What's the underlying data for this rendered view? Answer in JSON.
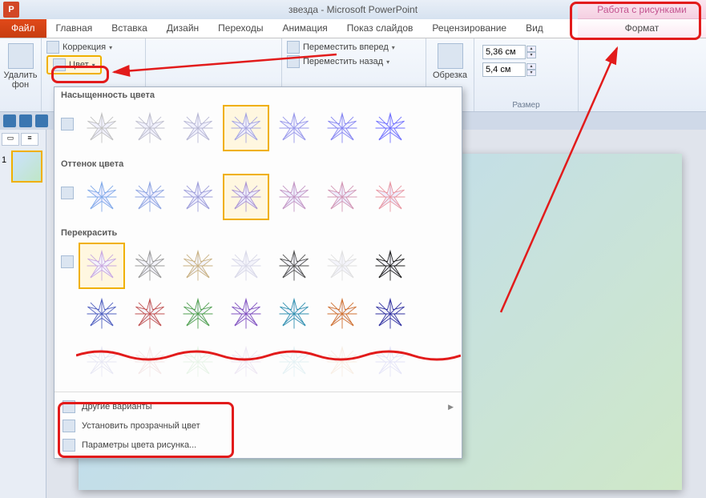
{
  "title": "звезда  -  Microsoft PowerPoint",
  "context_tab_title": "Работа с рисунками",
  "tabs": {
    "file": "Файл",
    "home": "Главная",
    "insert": "Вставка",
    "design": "Дизайн",
    "transitions": "Переходы",
    "animations": "Анимация",
    "slideshow": "Показ слайдов",
    "review": "Рецензирование",
    "view": "Вид",
    "format": "Формат"
  },
  "ribbon": {
    "remove_bg": "Удалить\nфон",
    "corrections": "Коррекция",
    "color": "Цвет",
    "bring_forward": "Переместить вперед",
    "send_backward": "Переместить назад",
    "crop": "Обрезка",
    "height": "5,36 см",
    "width": "5,4 см",
    "size_label": "Размер"
  },
  "dropdown": {
    "saturation": "Насыщенность цвета",
    "tone": "Оттенок цвета",
    "recolor": "Перекрасить",
    "more_variants": "Другие варианты",
    "set_transparent": "Установить прозрачный цвет",
    "picture_color_options": "Параметры цвета рисунка..."
  },
  "slide_number": "1"
}
